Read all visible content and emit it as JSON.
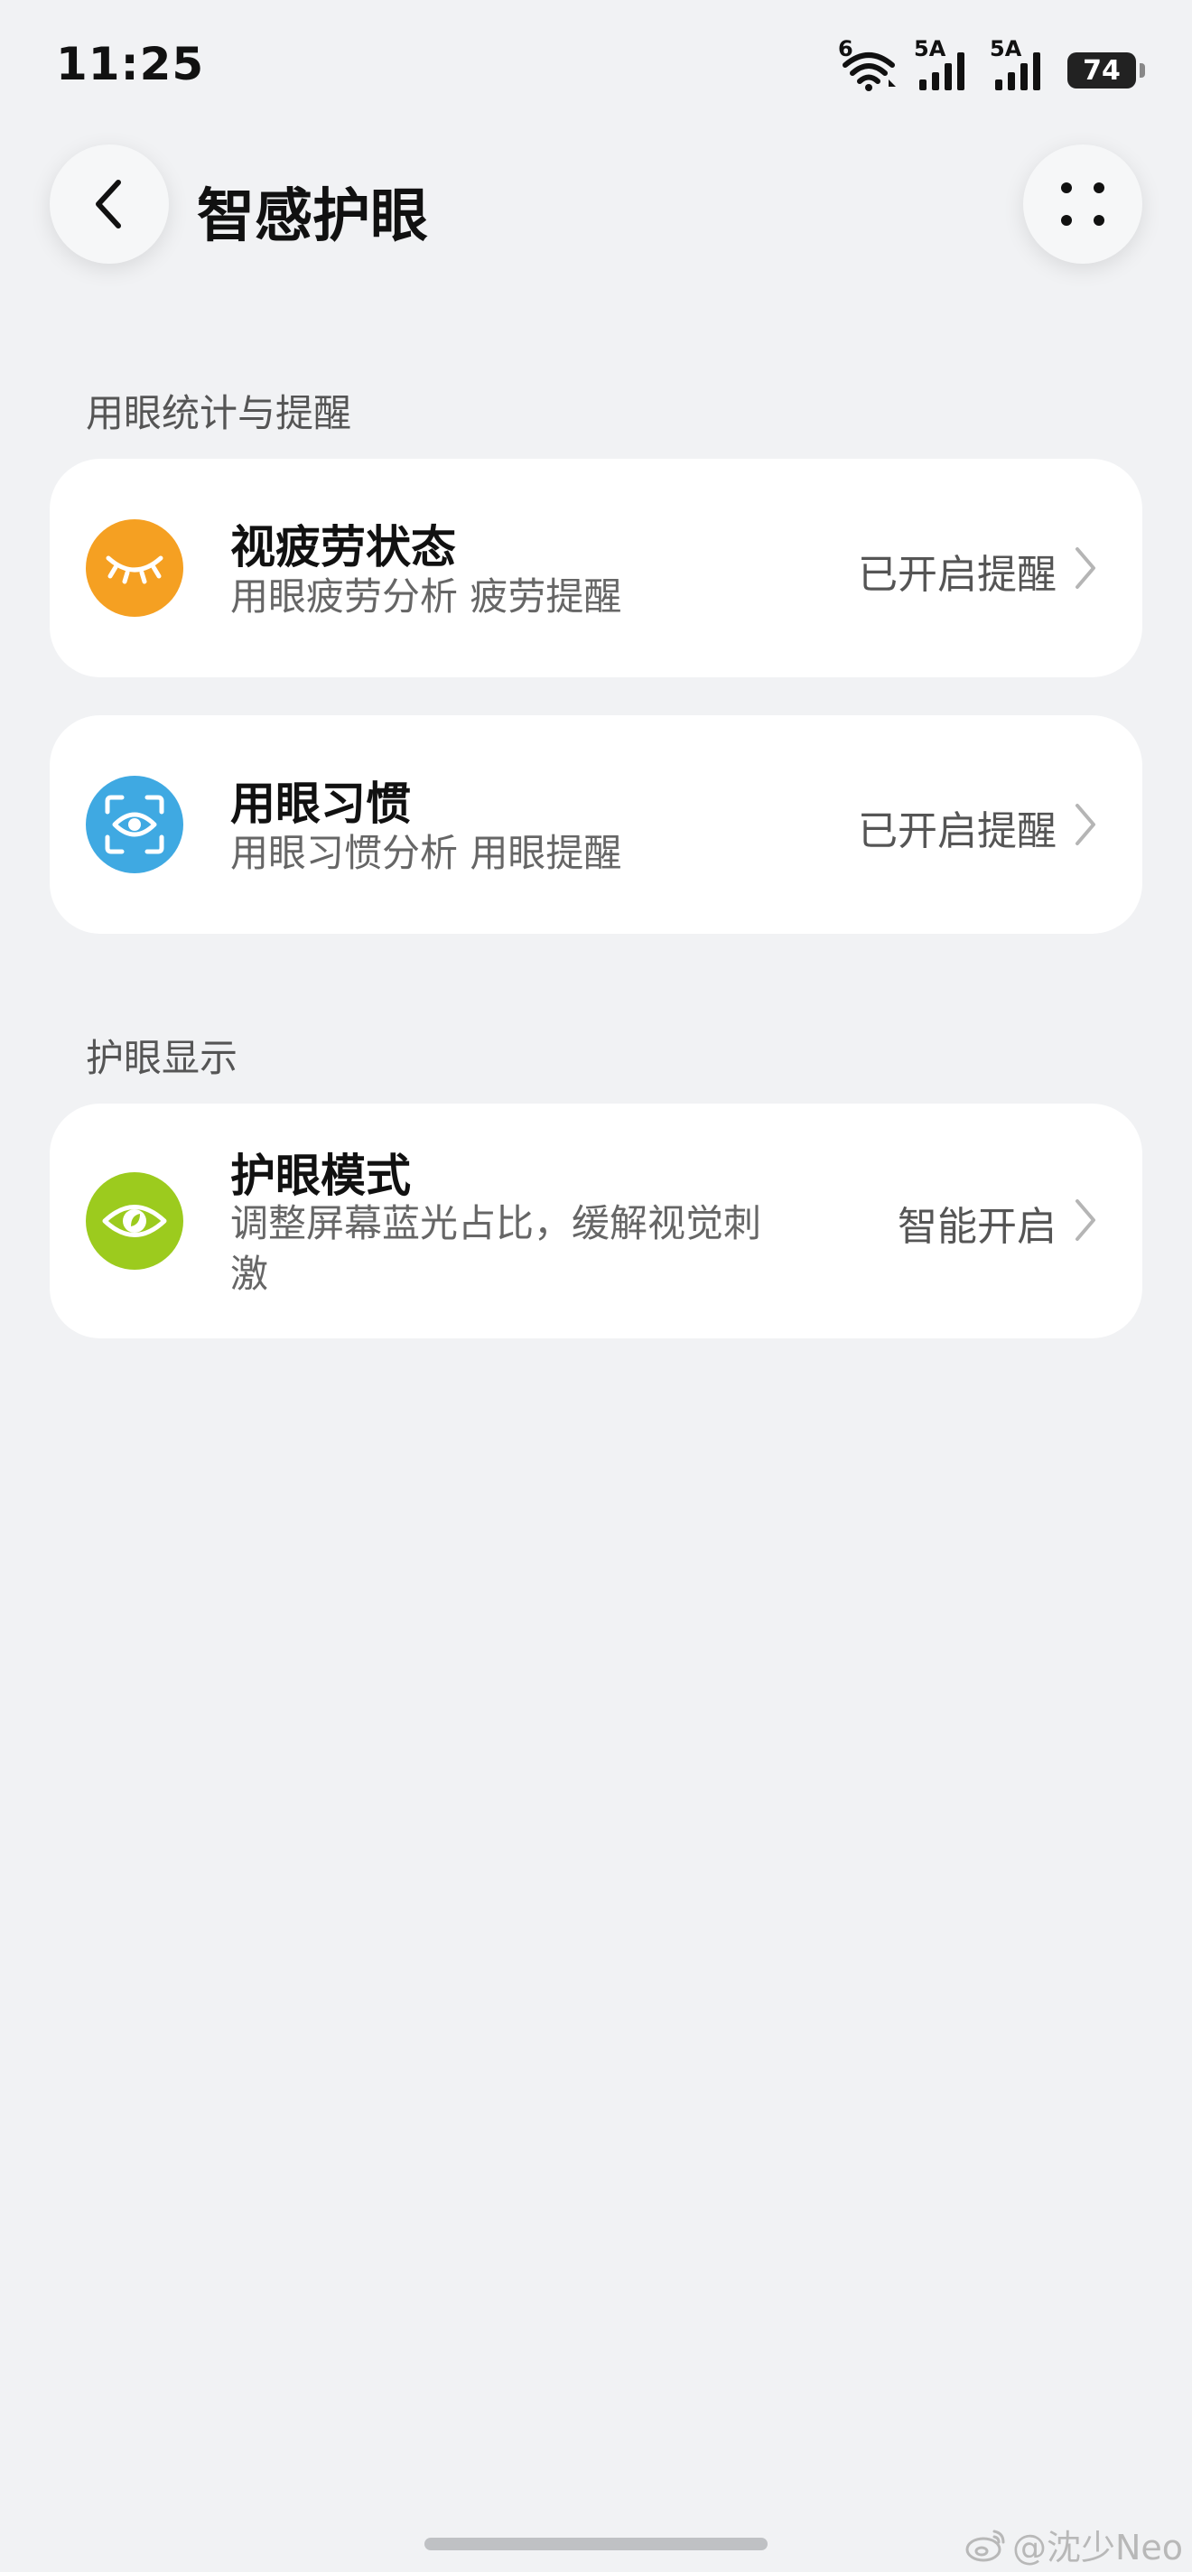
{
  "status_bar": {
    "time": "11:25",
    "wifi_label": "6",
    "sim1_label": "5A",
    "sim2_label": "5A",
    "battery": "74"
  },
  "header": {
    "title": "智感护眼",
    "back_icon": "chevron-left-icon",
    "more_icon": "more-dots-icon"
  },
  "sections": [
    {
      "label": "用眼统计与提醒",
      "items": [
        {
          "title": "视疲劳状态",
          "subtitle": "用眼疲劳分析 疲劳提醒",
          "status": "已开启提醒",
          "icon": "closed-eye-icon",
          "icon_color": "#F5A022"
        },
        {
          "title": "用眼习惯",
          "subtitle": "用眼习惯分析 用眼提醒",
          "status": "已开启提醒",
          "icon": "eye-scan-icon",
          "icon_color": "#3FA9E2"
        }
      ]
    },
    {
      "label": "护眼显示",
      "items": [
        {
          "title": "护眼模式",
          "subtitle_line1": "调整屏幕蓝光占比，缓解视觉刺",
          "subtitle_line2": "激",
          "status": "智能开启",
          "icon": "eye-leaf-icon",
          "icon_color": "#9CCB1E"
        }
      ]
    }
  ],
  "watermark": {
    "text": "@沈少Neo",
    "icon": "weibo-icon"
  }
}
